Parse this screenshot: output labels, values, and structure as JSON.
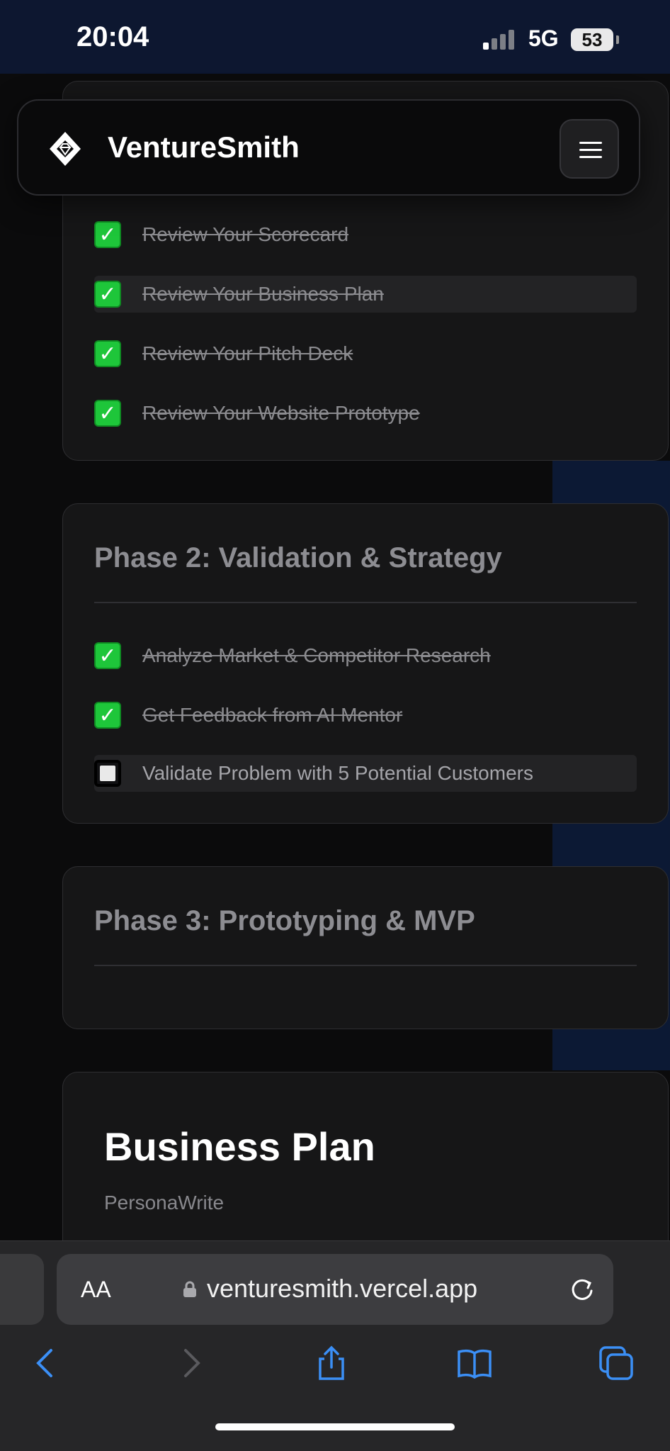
{
  "status_bar": {
    "time": "20:04",
    "network": "5G",
    "battery": "53"
  },
  "nav": {
    "brand": "VentureSmith",
    "logo_icon": "diamond-logo-icon",
    "menu_icon": "hamburger-menu-icon"
  },
  "phase1": {
    "tasks": [
      {
        "label": "Review Your Scorecard",
        "done": true
      },
      {
        "label": "Review Your Business Plan",
        "done": true
      },
      {
        "label": "Review Your Pitch Deck",
        "done": true
      },
      {
        "label": "Review Your Website Prototype",
        "done": true
      }
    ]
  },
  "phase2": {
    "title": "Phase 2: Validation & Strategy",
    "tasks": [
      {
        "label": "Analyze Market & Competitor Research",
        "done": true
      },
      {
        "label": "Get Feedback from AI Mentor",
        "done": true
      },
      {
        "label": "Validate Problem with 5 Potential Customers",
        "done": false
      }
    ]
  },
  "phase3": {
    "title": "Phase 3: Prototyping & MVP"
  },
  "business_plan": {
    "title": "Business Plan",
    "subtitle": "PersonaWrite"
  },
  "browser": {
    "text_size_label": "AA",
    "url": "venturesmith.vercel.app",
    "toolbar_icons": [
      "back-icon",
      "forward-icon",
      "share-icon",
      "bookmarks-icon",
      "tabs-icon"
    ]
  },
  "colors": {
    "check_green": "#1ec63a",
    "accent_blue": "#3b8ff6",
    "status_bar_bg": "#0d1730"
  }
}
